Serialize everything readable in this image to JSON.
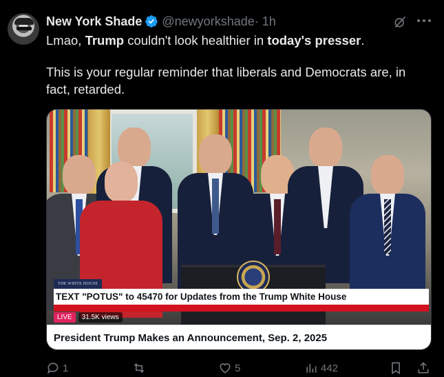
{
  "author": {
    "name": "New York Shade",
    "handle": "@newyorkshade",
    "time": " · 1h",
    "verified_color": "#1d9bf0"
  },
  "tweet": {
    "line1": [
      "Lmao, ",
      "Trump",
      " couldn't look healthier in ",
      "today's",
      " ",
      "presser",
      "."
    ],
    "line2": "This is your regular reminder that liberals and Democrats are, in fact, retarded."
  },
  "media": {
    "overlay_tag": "THE WHITE HOUSE",
    "overlay_headline": "TEXT \"POTUS\" to 45470 for Updates from the Trump White House",
    "live_label": "LIVE",
    "views": "31.5K views",
    "caption": "President Trump Makes an Announcement, Sep. 2, 2025"
  },
  "actions": {
    "replies": "1",
    "retweets": "",
    "likes": "5",
    "views": "442"
  },
  "icons": [
    "avatar",
    "verified-icon",
    "grok-icon",
    "more-icon",
    "reply-icon",
    "retweet-icon",
    "like-icon",
    "views-icon",
    "bookmark-icon",
    "share-icon"
  ],
  "colors": {
    "background": "#000000",
    "text": "#e7e9ea",
    "muted": "#71767b",
    "accent": "#1d9bf0",
    "banner_red": "#d1121f"
  }
}
